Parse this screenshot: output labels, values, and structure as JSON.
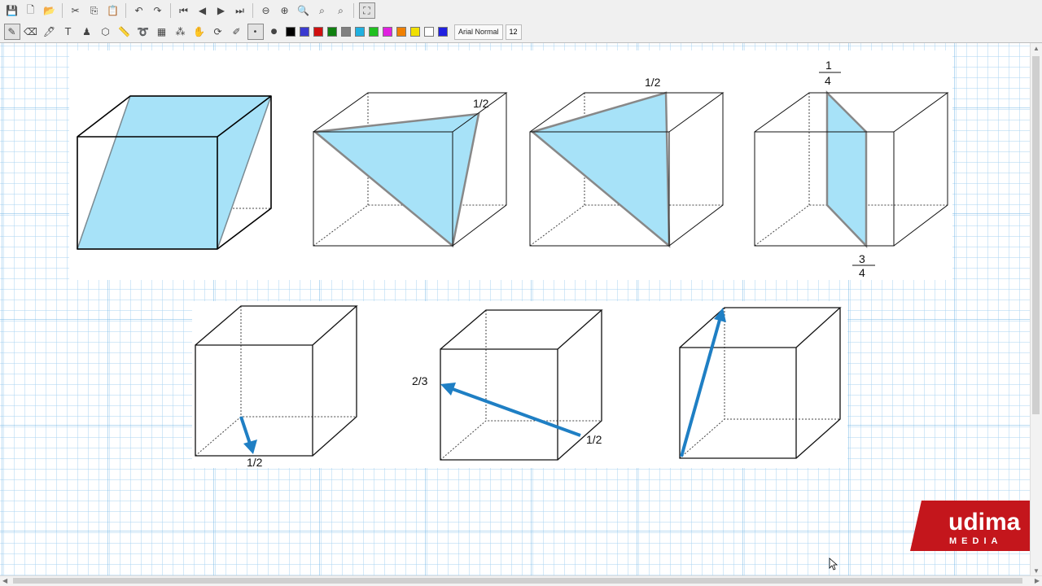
{
  "toolbar_top": {
    "icons": [
      "save-icon",
      "new-icon",
      "open-icon",
      "cut-icon",
      "copy-icon",
      "paste-icon",
      "undo-icon",
      "redo-icon",
      "first-page-icon",
      "prev-page-icon",
      "next-page-icon",
      "last-page-icon",
      "zoom-out-icon",
      "zoom-in-icon",
      "zoom-icon",
      "zoom-fit-icon",
      "zoom-reset-icon",
      "fullscreen-icon"
    ]
  },
  "toolbar_draw": {
    "tools": [
      "pen-icon",
      "eraser-icon",
      "highlighter-icon",
      "text-icon",
      "stamp-icon",
      "shape-icon",
      "ruler-icon",
      "lasso-icon",
      "fill-icon",
      "spray-icon",
      "hand-icon",
      "refresh-icon",
      "color-picker-icon"
    ],
    "colors": [
      "#000000",
      "#3a3ad0",
      "#d01010",
      "#108010",
      "#808080",
      "#20b0e0",
      "#20c020",
      "#e020e0",
      "#f08000",
      "#f0e000",
      "#ffffff",
      "#2020e0"
    ],
    "font_name": "Arial Normal",
    "font_size": "12"
  },
  "canvas": {
    "labels": {
      "c2_half": "1/2",
      "c3_half": "1/2",
      "c4_num": "1",
      "c4_den": "4",
      "c4_num2": "3",
      "c4_den2": "4",
      "v1_half": "1/2",
      "v2_twothirds": "2/3",
      "v2_half": "1/2"
    },
    "fill_color": "#a7e2f8",
    "arrow_color": "#1f7fc4"
  },
  "logo": {
    "brand": "udima",
    "sub": "MEDIA",
    "color": "#c4161c"
  }
}
